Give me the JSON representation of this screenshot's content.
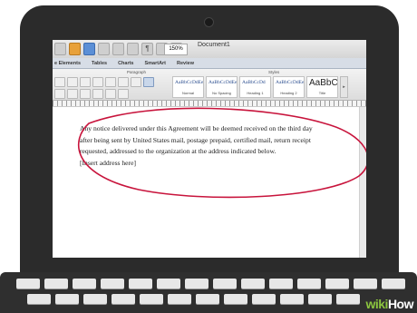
{
  "window": {
    "title": "Document1",
    "zoom": "150%"
  },
  "tabs": [
    "e Elements",
    "Tables",
    "Charts",
    "SmartArt",
    "Review"
  ],
  "ribbon": {
    "paragraph_group": "Paragraph",
    "styles_group": "Styles",
    "styles": [
      {
        "sample": "AaBbCcDdEe",
        "name": "Normal"
      },
      {
        "sample": "AaBbCcDdEe",
        "name": "No Spacing"
      },
      {
        "sample": "AaBbCcDd",
        "name": "Heading 1"
      },
      {
        "sample": "AaBbCcDdEe",
        "name": "Heading 2"
      },
      {
        "sample": "AaBbC",
        "name": "Title"
      }
    ]
  },
  "document": {
    "lines": [
      "Any notice delivered under this Agreement will be deemed received on the third day",
      "after being sent by United States mail, postage prepaid, certified mail, return receipt",
      "requested, addressed to the organization at the address indicated below.",
      "[Insert address here]"
    ]
  },
  "colors": {
    "annotation_ellipse": "#c8143c",
    "watermark_accent": "#8cc63f"
  },
  "watermark": {
    "prefix": "wiki",
    "suffix": "How"
  }
}
